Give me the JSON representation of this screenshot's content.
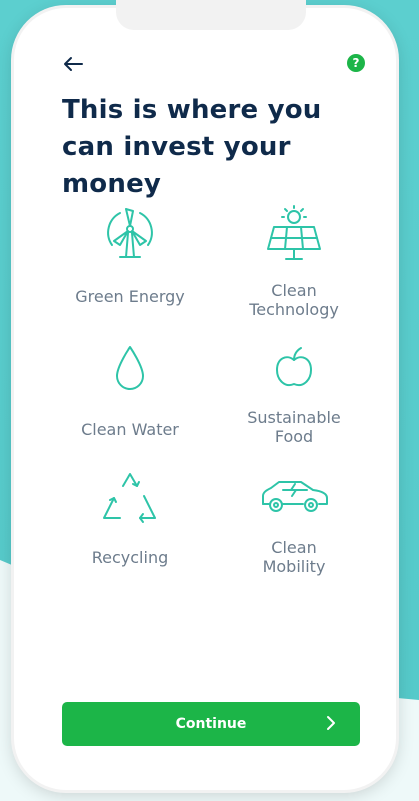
{
  "header": {
    "title": "This is where you can invest your money"
  },
  "categories": [
    {
      "label": "Green Energy",
      "icon": "wind-turbine-icon"
    },
    {
      "label": "Clean\nTechnology",
      "icon": "solar-panel-icon"
    },
    {
      "label": "Clean Water",
      "icon": "water-drop-icon"
    },
    {
      "label": "Sustainable\nFood",
      "icon": "apple-icon"
    },
    {
      "label": "Recycling",
      "icon": "recycle-icon"
    },
    {
      "label": "Clean\nMobility",
      "icon": "electric-car-icon"
    }
  ],
  "footer": {
    "continue_label": "Continue"
  },
  "colors": {
    "accent": "#1cb548",
    "title": "#0f2a4a",
    "icon": "#2ec4a8",
    "label": "#6d7c8c",
    "background": "#5ccfcf"
  }
}
